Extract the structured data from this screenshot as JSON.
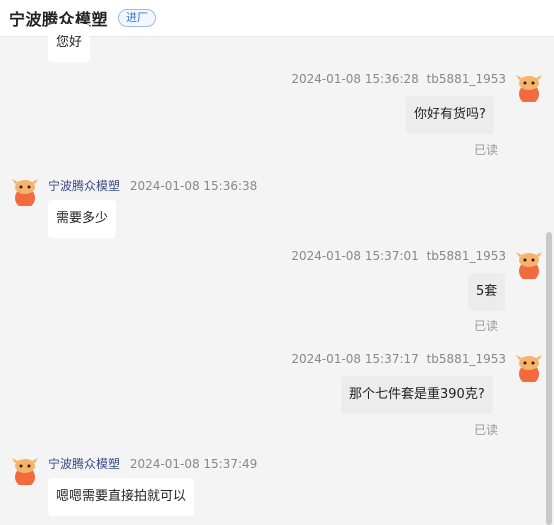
{
  "header": {
    "shop_name": "宁波腾众模塑",
    "tag": "进厂"
  },
  "messages": [
    {
      "side": "left",
      "text": "您好"
    },
    {
      "side": "right",
      "time": "2024-01-08 15:36:28",
      "user": "tb5881_1953",
      "text": "你好有货吗?",
      "status": "已读"
    },
    {
      "side": "left",
      "sender": "宁波腾众模塑",
      "time": "2024-01-08 15:36:38",
      "text": "需要多少"
    },
    {
      "side": "right",
      "time": "2024-01-08 15:37:01",
      "user": "tb5881_1953",
      "text": "5套",
      "status": "已读"
    },
    {
      "side": "right",
      "time": "2024-01-08 15:37:17",
      "user": "tb5881_1953",
      "text": "那个七件套是重390克?",
      "status": "已读"
    },
    {
      "side": "left",
      "sender": "宁波腾众模塑",
      "time": "2024-01-08 15:37:49",
      "text": "嗯嗯需要直接拍就可以"
    }
  ],
  "colors": {
    "accent": "#3b6fd6",
    "avatar": "#f26a3d"
  },
  "icons": {
    "avatar": "cartoon-avatar-icon"
  }
}
